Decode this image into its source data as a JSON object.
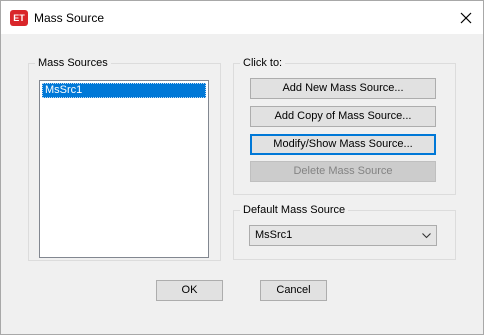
{
  "window": {
    "app_icon_text": "ET",
    "title": "Mass Source",
    "close_icon": "close-icon"
  },
  "mass_sources": {
    "legend": "Mass Sources",
    "items": [
      "MsSrc1"
    ],
    "selected": "MsSrc1"
  },
  "click_to": {
    "legend": "Click to:",
    "add_new": "Add New Mass Source...",
    "add_copy": "Add Copy of Mass Source...",
    "modify_show": "Modify/Show Mass Source...",
    "delete": "Delete Mass Source"
  },
  "default_mass_source": {
    "legend": "Default Mass Source",
    "value": "MsSrc1"
  },
  "footer": {
    "ok": "OK",
    "cancel": "Cancel"
  },
  "colors": {
    "selection": "#0078d7",
    "app_icon": "#d9262a",
    "focus_border": "#0078d7"
  }
}
